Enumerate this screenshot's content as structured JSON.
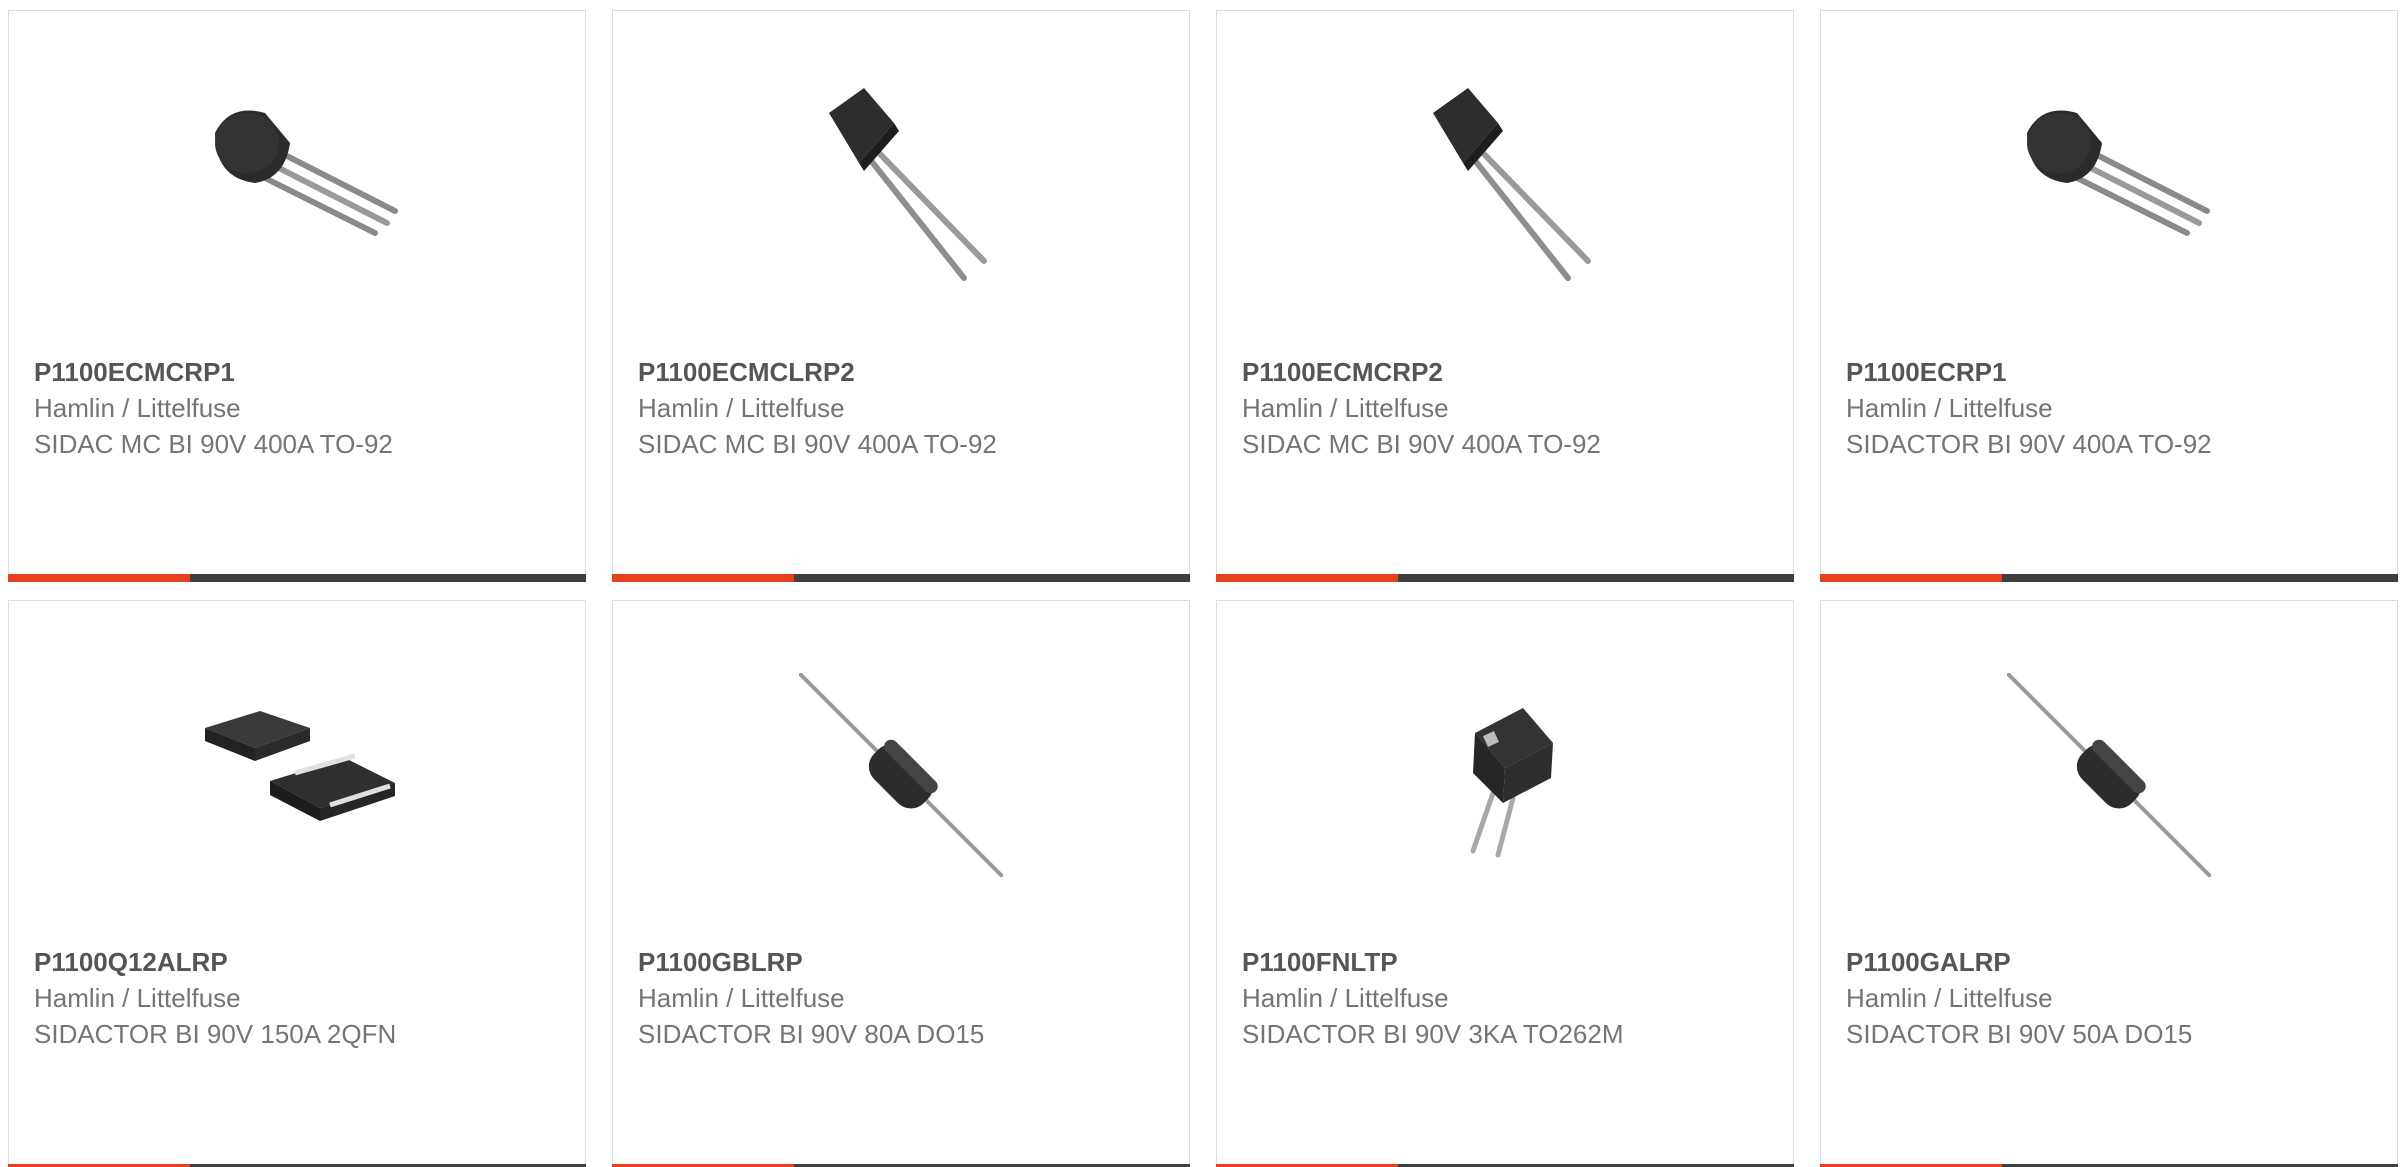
{
  "colors": {
    "accent": "#e8401c",
    "bar": "#3f3f3f",
    "border": "#dcdcdc",
    "part_number": "#555555",
    "secondary_text": "#757575"
  },
  "products": [
    {
      "part_number": "P1100ECMCRP1",
      "manufacturer": "Hamlin / Littelfuse",
      "description": "SIDAC MC BI 90V 400A TO-92",
      "image": "to92-round-icon"
    },
    {
      "part_number": "P1100ECMCLRP2",
      "manufacturer": "Hamlin / Littelfuse",
      "description": "SIDAC MC BI 90V 400A TO-92",
      "image": "to92-flat-icon"
    },
    {
      "part_number": "P1100ECMCRP2",
      "manufacturer": "Hamlin / Littelfuse",
      "description": "SIDAC MC BI 90V 400A TO-92",
      "image": "to92-flat-icon"
    },
    {
      "part_number": "P1100ECRP1",
      "manufacturer": "Hamlin / Littelfuse",
      "description": "SIDACTOR BI 90V 400A TO-92",
      "image": "to92-round-icon"
    },
    {
      "part_number": "P1100Q12ALRP",
      "manufacturer": "Hamlin / Littelfuse",
      "description": "SIDACTOR BI 90V 150A 2QFN",
      "image": "qfn-package-icon"
    },
    {
      "part_number": "P1100GBLRP",
      "manufacturer": "Hamlin / Littelfuse",
      "description": "SIDACTOR BI 90V 80A DO15",
      "image": "do15-axial-icon"
    },
    {
      "part_number": "P1100FNLTP",
      "manufacturer": "Hamlin / Littelfuse",
      "description": "SIDACTOR BI 90V 3KA TO262M",
      "image": "to262-package-icon"
    },
    {
      "part_number": "P1100GALRP",
      "manufacturer": "Hamlin / Littelfuse",
      "description": "SIDACTOR BI 90V 50A DO15",
      "image": "do15-axial-icon"
    }
  ]
}
